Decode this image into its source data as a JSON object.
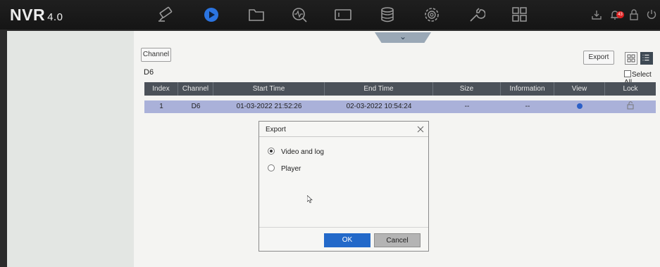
{
  "app": {
    "brand": "NVR",
    "version": "4.0"
  },
  "nav_icons": [
    "camera-icon",
    "playback-icon",
    "folder-icon",
    "search-icon",
    "display-icon",
    "storage-icon",
    "settings-icon",
    "wrench-icon",
    "grid-icon"
  ],
  "status_icons": [
    "download-icon",
    "alarm-icon",
    "lock-icon",
    "power-icon"
  ],
  "alarm_count": "43",
  "toolbar": {
    "channel_label": "Channel",
    "export_label": "Export",
    "current_channel": "D6",
    "select_all_label": "Select All"
  },
  "table": {
    "columns": [
      "Index",
      "Channel",
      "Start Time",
      "End Time",
      "Size",
      "Information",
      "View",
      "Lock"
    ],
    "rows": [
      {
        "index": "1",
        "channel": "D6",
        "start_time": "01-03-2022 21:52:26",
        "end_time": "02-03-2022 10:54:24",
        "size": "--",
        "information": "--"
      }
    ]
  },
  "export_dialog": {
    "title": "Export",
    "options": [
      {
        "label": "Video and log",
        "selected": true
      },
      {
        "label": "Player",
        "selected": false
      }
    ],
    "ok_label": "OK",
    "cancel_label": "Cancel"
  },
  "colors": {
    "top_bar": "#1b1b1b",
    "selected_row": "#aab1d9",
    "ok_button": "#2369c9",
    "play_accent": "#2b74e0",
    "alarm_badge": "#dd2222"
  }
}
